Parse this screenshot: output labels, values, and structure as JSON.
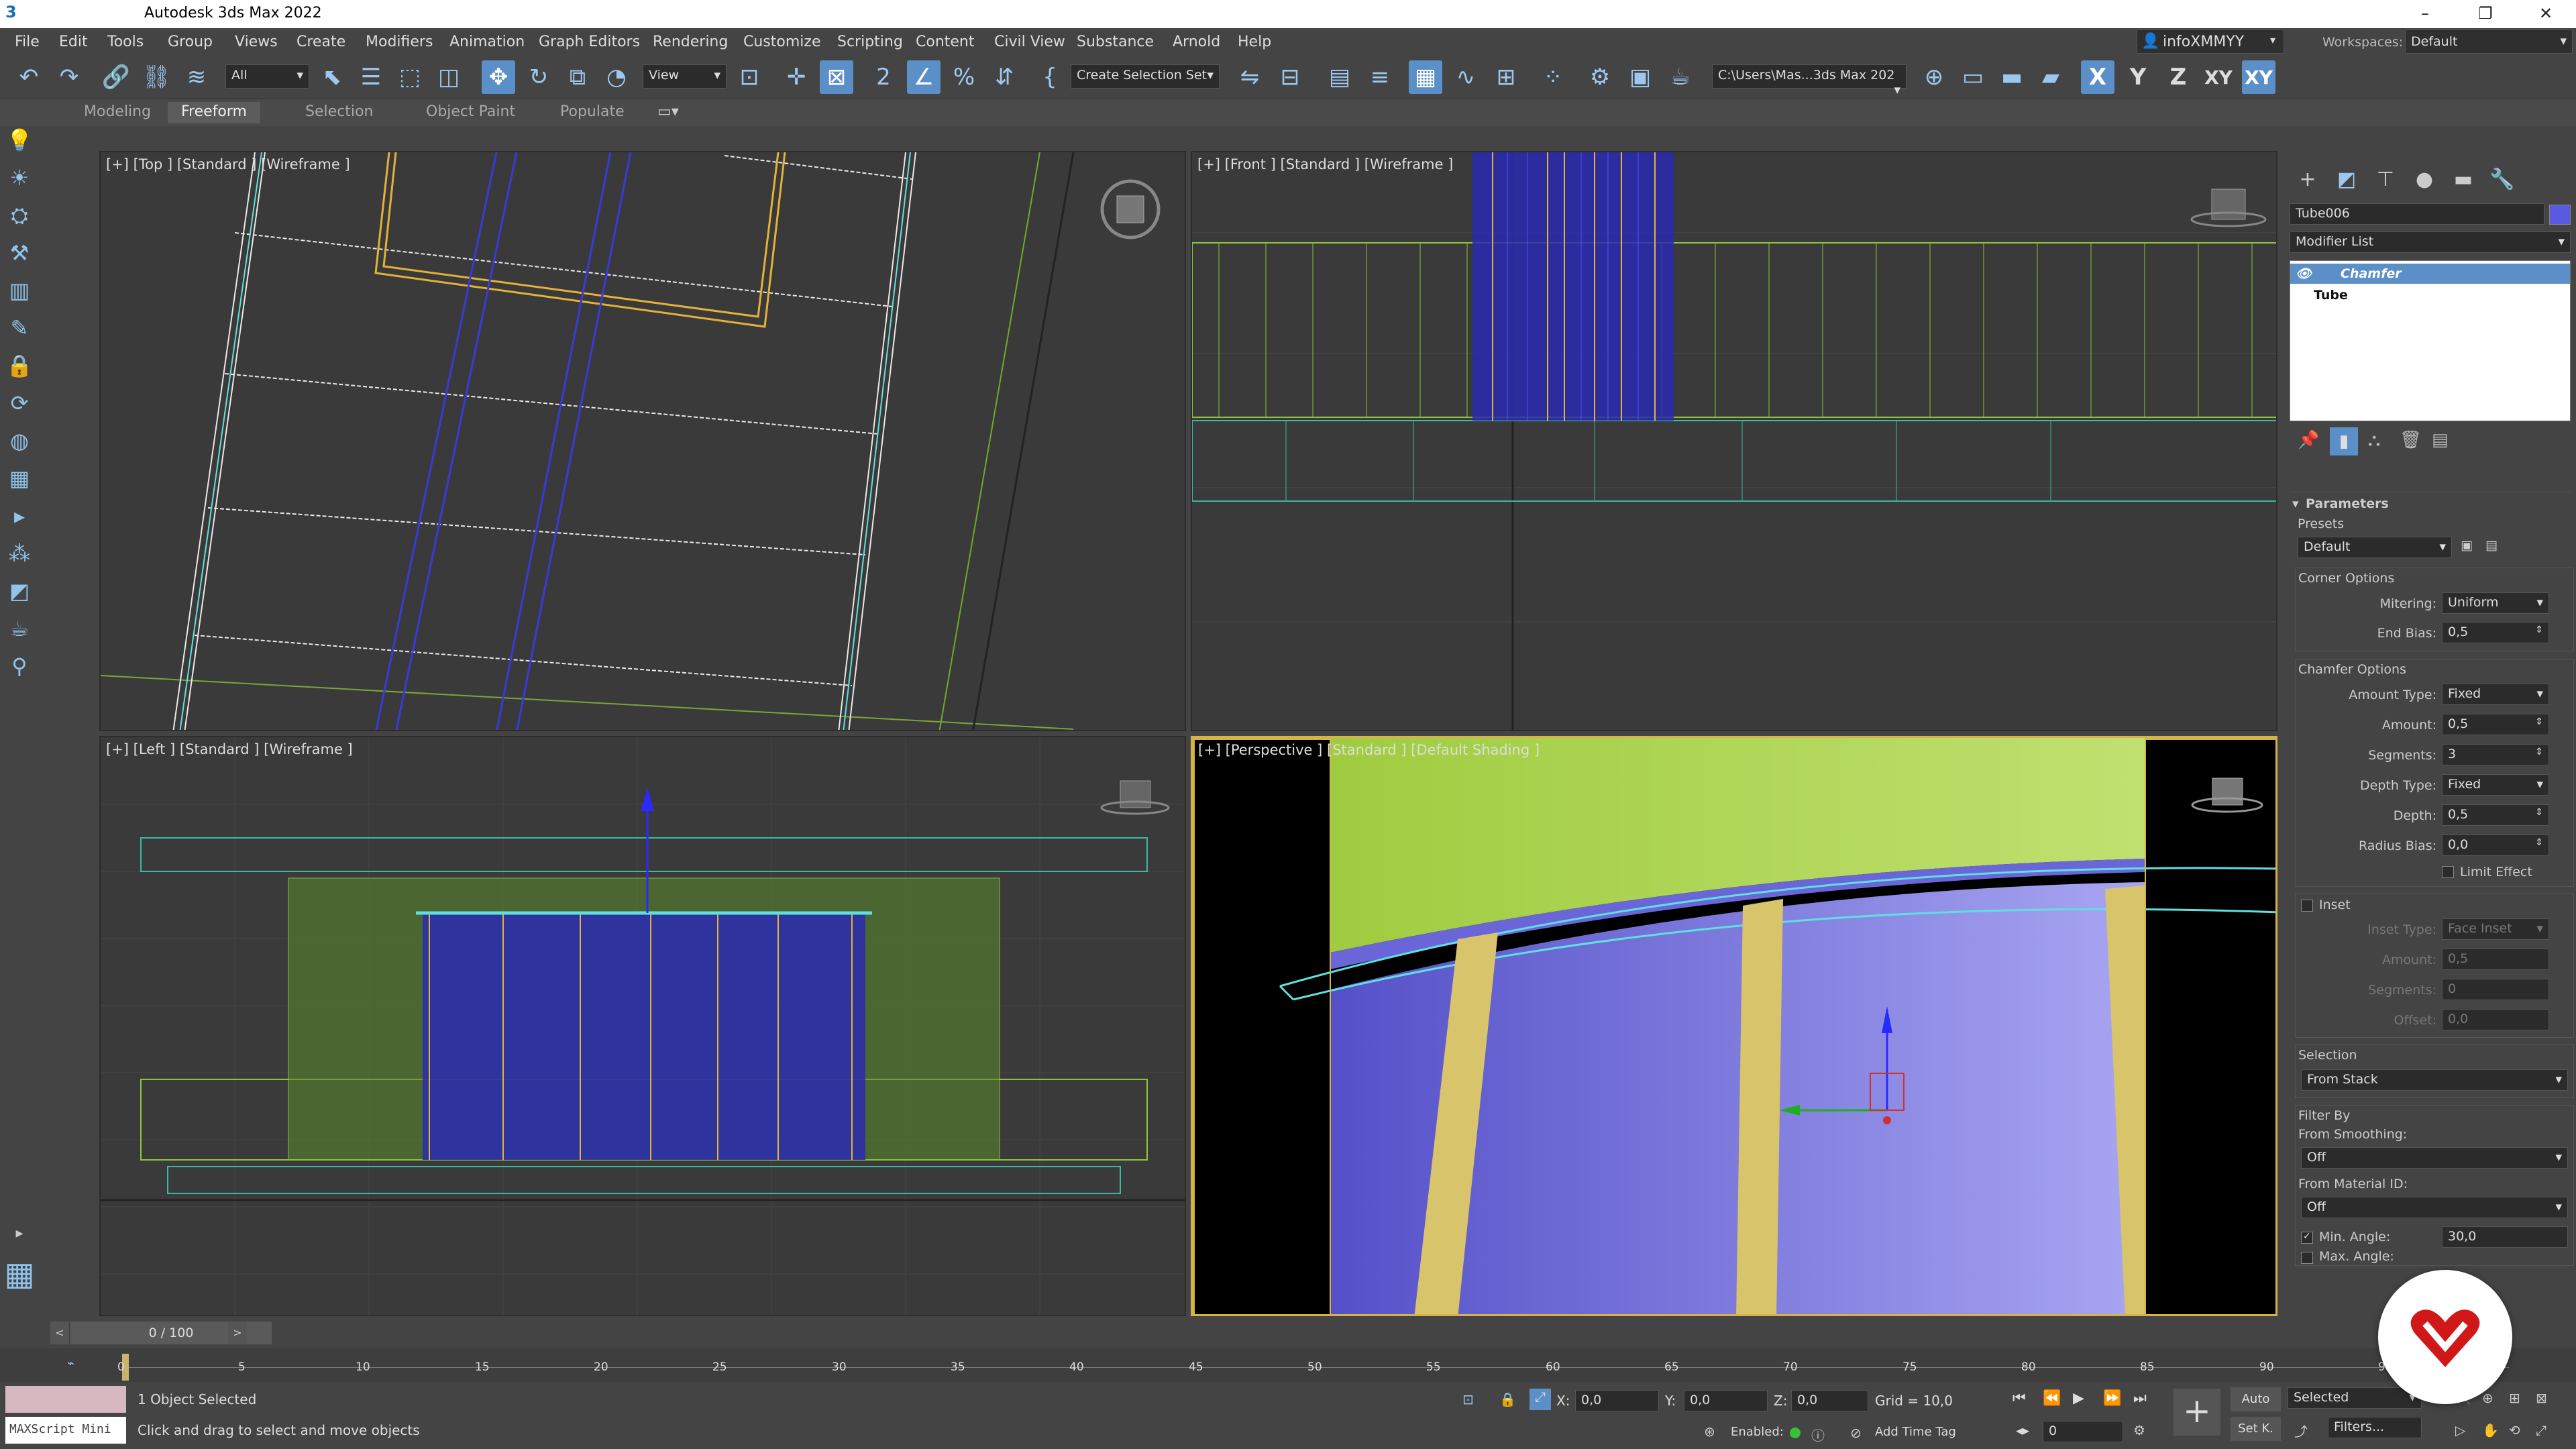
{
  "window": {
    "title": "Autodesk 3ds Max 2022",
    "min": "–",
    "max": "❐",
    "close": "✕"
  },
  "menu": [
    "File",
    "Edit",
    "Tools",
    "Group",
    "Views",
    "Create",
    "Modifiers",
    "Animation",
    "Graph Editors",
    "Rendering",
    "Customize",
    "Scripting",
    "Content",
    "Civil View",
    "Substance",
    "Arnold",
    "Help"
  ],
  "user": {
    "name": "infoXMMYY",
    "workspaces_label": "Workspaces:",
    "workspace": "Default"
  },
  "toolbar": {
    "filter": "All",
    "ref_coord": "View",
    "selection_set": "Create Selection Set",
    "project_path": "C:\\Users\\Mas...3ds Max 202",
    "axis_x": "X",
    "axis_y": "Y",
    "axis_z": "Z",
    "axis_xy": "XY",
    "axis_xyc": "XY"
  },
  "ribbon": {
    "tabs": [
      "Modeling",
      "Freeform",
      "Selection",
      "Object Paint",
      "Populate"
    ],
    "active": "Freeform"
  },
  "viewports": {
    "top": "[+] [Top ] [Standard ] [Wireframe ]",
    "front": "[+] [Front ] [Standard ] [Wireframe ]",
    "left": "[+] [Left ] [Standard ] [Wireframe ]",
    "perspective": "[+] [Perspective ] [Standard ] [Default Shading ]"
  },
  "command_panel": {
    "object_name": "Tube006",
    "object_color": "#5a5ae0",
    "modifier_list": "Modifier List",
    "stack": [
      "Chamfer",
      "Tube"
    ],
    "rollout": "Parameters",
    "presets_label": "Presets",
    "presets_value": "Default",
    "corner_options": "Corner Options",
    "mitering_label": "Mitering:",
    "mitering": "Uniform",
    "end_bias_label": "End Bias:",
    "end_bias": "0,5",
    "chamfer_options": "Chamfer Options",
    "amount_type_label": "Amount Type:",
    "amount_type": "Fixed",
    "amount_label": "Amount:",
    "amount": "0,5",
    "segments_label": "Segments:",
    "segments": "3",
    "depth_type_label": "Depth Type:",
    "depth_type": "Fixed",
    "depth_label": "Depth:",
    "depth": "0,5",
    "radius_bias_label": "Radius Bias:",
    "radius_bias": "0,0",
    "limit_effect": "Limit Effect",
    "inset": "Inset",
    "inset_type_label": "Inset Type:",
    "inset_type": "Face Inset",
    "inset_amount_label": "Amount:",
    "inset_amount": "0,5",
    "inset_segments_label": "Segments:",
    "inset_segments": "0",
    "offset_label": "Offset:",
    "offset": "0,0",
    "selection": "Selection",
    "selection_value": "From Stack",
    "filter_by": "Filter By",
    "from_smoothing": "From Smoothing:",
    "from_smoothing_value": "Off",
    "from_material": "From Material ID:",
    "from_material_value": "Off",
    "min_angle_label": "Min. Angle:",
    "min_angle": "30,0",
    "max_angle_label": "Max. Angle:"
  },
  "timeline": {
    "frame": "0 / 100",
    "ticks": [
      "0",
      "5",
      "10",
      "15",
      "20",
      "25",
      "30",
      "35",
      "40",
      "45",
      "50",
      "55",
      "60",
      "65",
      "70",
      "75",
      "80",
      "85",
      "90",
      "95"
    ]
  },
  "status": {
    "maxscript": "MAXScript Mini",
    "selected": "1 Object Selected",
    "prompt": "Click and drag to select and move objects",
    "x_label": "X:",
    "x": "0,0",
    "y_label": "Y:",
    "y": "0,0",
    "z_label": "Z:",
    "z": "0,0",
    "grid": "Grid = 10,0",
    "enabled": "Enabled:",
    "add_time_tag": "Add Time Tag",
    "auto": "Auto",
    "selected_mode": "Selected",
    "setk": "Set K.",
    "filters": "Filters...",
    "frame_input": "0"
  },
  "colors": {
    "accent": "#5b8fc7",
    "active_viewport": "#d4b34a",
    "wire_green": "#8fc33a",
    "wire_blue": "#3a3ad8",
    "wire_yellow": "#e2b23a",
    "wire_cyan": "#5fe0e0",
    "persp_purple": "#7a74e6",
    "persp_green": "#a8d24a",
    "persp_gold": "#d8c46a"
  }
}
